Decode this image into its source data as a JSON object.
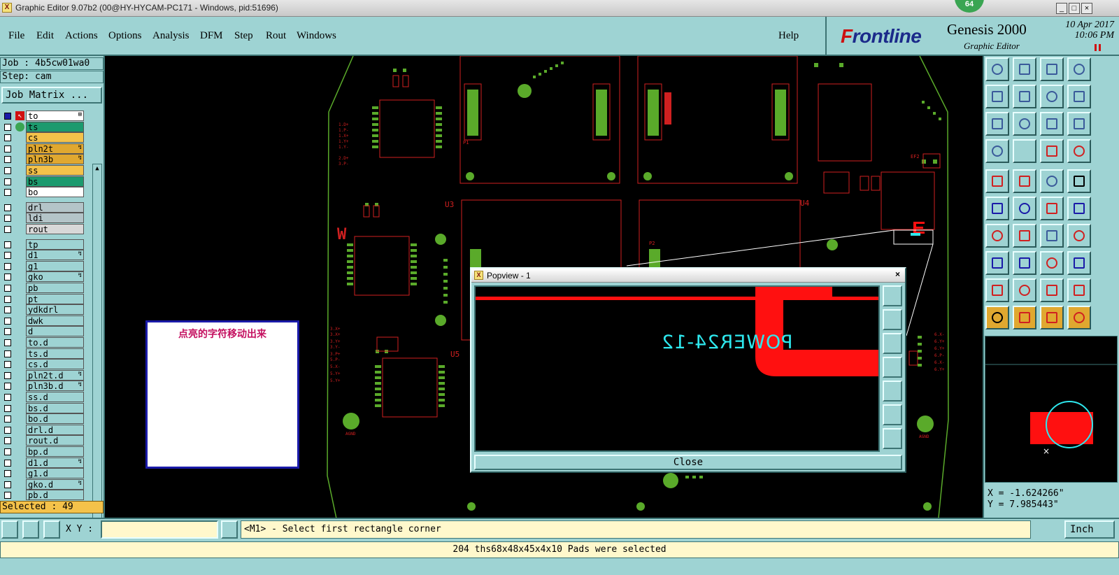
{
  "window": {
    "title": "Graphic Editor 9.07b2 (00@HY-HYCAM-PC171 - Windows, pid:51696)",
    "badge": "64",
    "min": "_",
    "max": "□",
    "close": "×"
  },
  "menu": [
    "File",
    "Edit",
    "Actions",
    "Options",
    "Analysis",
    "DFM",
    "Step",
    "Rout",
    "Windows"
  ],
  "help": "Help",
  "brand": {
    "logo_a": "F",
    "logo_b": "rontline",
    "product": "Genesis 2000",
    "subtitle": "Graphic Editor",
    "date": "10 Apr 2017",
    "time": "10:06 PM"
  },
  "job": {
    "job_line": "Job : 4b5cw01wa0",
    "step_line": "Step: cam",
    "matrix_button": "Job Matrix ..."
  },
  "layers": [
    {
      "name": "to",
      "color": "#ffffff",
      "tw": "⊞"
    },
    {
      "name": "ts",
      "color": "#1c9a6e",
      "tw": ""
    },
    {
      "name": "cs",
      "color": "#f4c24a",
      "tw": ""
    },
    {
      "name": "pln2t",
      "color": "#e0a830",
      "tw": "↯"
    },
    {
      "name": "pln3b",
      "color": "#e0a830",
      "tw": "↯"
    },
    {
      "name": "ss",
      "color": "#f4c24a",
      "tw": ""
    },
    {
      "name": "bs",
      "color": "#1c9a6e",
      "tw": ""
    },
    {
      "name": "bo",
      "color": "#ffffff",
      "tw": ""
    },
    {
      "name": "drl",
      "color": "#b4c4c8",
      "tw": ""
    },
    {
      "name": "ldi",
      "color": "#b4c4c8",
      "tw": ""
    },
    {
      "name": "rout",
      "color": "#d8d8d8",
      "tw": ""
    },
    {
      "name": "tp",
      "color": "#9ed3d3",
      "tw": ""
    },
    {
      "name": "d1",
      "color": "#9ed3d3",
      "tw": "↯"
    },
    {
      "name": "g1",
      "color": "#9ed3d3",
      "tw": ""
    },
    {
      "name": "gko",
      "color": "#9ed3d3",
      "tw": "↯"
    },
    {
      "name": "pb",
      "color": "#9ed3d3",
      "tw": ""
    },
    {
      "name": "pt",
      "color": "#9ed3d3",
      "tw": ""
    },
    {
      "name": "ydkdrl",
      "color": "#9ed3d3",
      "tw": ""
    },
    {
      "name": "dwk",
      "color": "#9ed3d3",
      "tw": ""
    },
    {
      "name": "d",
      "color": "#9ed3d3",
      "tw": ""
    },
    {
      "name": "to.d",
      "color": "#9ed3d3",
      "tw": ""
    },
    {
      "name": "ts.d",
      "color": "#9ed3d3",
      "tw": ""
    },
    {
      "name": "cs.d",
      "color": "#9ed3d3",
      "tw": ""
    },
    {
      "name": "pln2t.d",
      "color": "#9ed3d3",
      "tw": "↯"
    },
    {
      "name": "pln3b.d",
      "color": "#9ed3d3",
      "tw": "↯"
    },
    {
      "name": "ss.d",
      "color": "#9ed3d3",
      "tw": ""
    },
    {
      "name": "bs.d",
      "color": "#9ed3d3",
      "tw": ""
    },
    {
      "name": "bo.d",
      "color": "#9ed3d3",
      "tw": ""
    },
    {
      "name": "drl.d",
      "color": "#9ed3d3",
      "tw": ""
    },
    {
      "name": "rout.d",
      "color": "#9ed3d3",
      "tw": ""
    },
    {
      "name": "bp.d",
      "color": "#9ed3d3",
      "tw": ""
    },
    {
      "name": "d1.d",
      "color": "#9ed3d3",
      "tw": "↯"
    },
    {
      "name": "g1.d",
      "color": "#9ed3d3",
      "tw": ""
    },
    {
      "name": "gko.d",
      "color": "#9ed3d3",
      "tw": "↯"
    },
    {
      "name": "pb.d",
      "color": "#9ed3d3",
      "tw": ""
    }
  ],
  "selected": "Selected : 49",
  "note": {
    "text": "点亮的字符移动出来"
  },
  "board": {
    "labels": [
      "U3",
      "U4",
      "U5",
      "W",
      "AGND",
      "AGND",
      "P1",
      "P2",
      "EF2"
    ]
  },
  "popview": {
    "title": "Popview - 1",
    "close_x": "×",
    "text": "POWER24-12",
    "close_button": "Close"
  },
  "coords": {
    "x": "X = -1.624266\"",
    "y": "Y = 7.985443\""
  },
  "bottom": {
    "xy_label": "X Y :",
    "xy_value": "",
    "prompt": "<M1> - Select first rectangle corner",
    "units": "Inch",
    "status": "204 ths68x48x45x4x10 Pads were selected"
  },
  "icons": {
    "tools": [
      "move-up-icon",
      "move-down-icon",
      "home-icon",
      "zoom-extents-icon",
      "pan-left-icon",
      "pan-right-icon",
      "undo-view-icon",
      "redraw-icon",
      "fit-screen-icon",
      "center-icon",
      "scale-1-2-icon",
      "help-query-icon",
      "measure-icon",
      "grid-icon",
      "layer-compare-icon",
      "layer-compare-alt-icon",
      "add-pad-icon",
      "add-rectangle-icon",
      "ruler-icon",
      "pad-select-icon",
      "connect-icon",
      "delete-icon",
      "move-point-icon",
      "net-icon",
      "draw-line-icon",
      "line-icon",
      "arc-icon",
      "flip-icon",
      "snap-icon",
      "bar-icon",
      "resize-icon",
      "copy-icon",
      "triangle-icon",
      "triangle-alt-icon",
      "triangle-outline-icon",
      "triangle-select-icon",
      "select-arrow-icon",
      "select-box-icon",
      "select-polygon-icon",
      "select-lasso-icon"
    ],
    "pv_buttons": [
      "pv-zoom-in-icon",
      "pv-up-icon",
      "pv-down-icon",
      "pv-left-icon",
      "pv-right-icon",
      "pv-fit-icon",
      "pv-center-icon"
    ]
  },
  "colors": {
    "panel": "#9ed3d3",
    "copper": "#ff0000",
    "pad": "#5aaa2a",
    "text_cyan": "#2ee8ee",
    "highlight": "#e0a830"
  }
}
